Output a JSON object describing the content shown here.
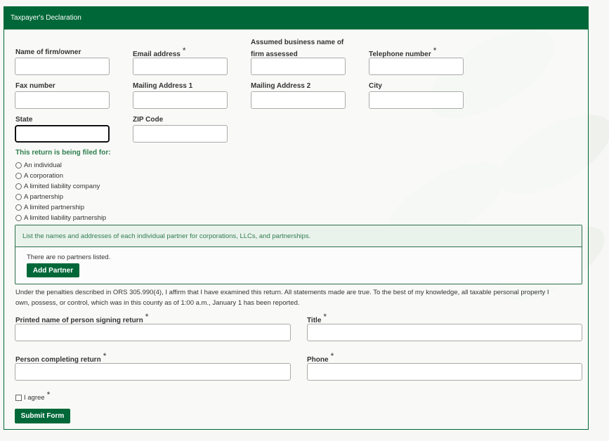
{
  "header": {
    "title": "Taxpayer's Declaration"
  },
  "fields": [
    {
      "label": "Name of firm/owner",
      "required": false,
      "value": ""
    },
    {
      "label": "Email address",
      "required": true,
      "value": ""
    },
    {
      "label": "Assumed business name of",
      "label2": "firm assessed",
      "required": false,
      "value": ""
    },
    {
      "label": "Telephone number",
      "required": true,
      "value": ""
    },
    {
      "label": "Fax number",
      "required": false,
      "value": ""
    },
    {
      "label": "Mailing Address 1",
      "required": false,
      "value": ""
    },
    {
      "label": "Mailing Address 2",
      "required": false,
      "value": ""
    },
    {
      "label": "City",
      "required": false,
      "value": ""
    },
    {
      "label": "State",
      "required": false,
      "value": "",
      "focused": true
    },
    {
      "label": "ZIP Code",
      "required": false,
      "value": ""
    }
  ],
  "filing": {
    "title": "This return is being filed for:",
    "options": [
      "An individual",
      "A corporation",
      "A limited liability company",
      "A partnership",
      "A limited partnership",
      "A limited liability partnership"
    ]
  },
  "partners": {
    "instruction": "List the names and addresses of each individual partner for corporations, LLCs, and partnerships.",
    "empty": "There are no partners listed.",
    "add_label": "Add Partner"
  },
  "declaration": {
    "line1": "Under the penalties described in ORS 305.990(4), I affirm that I have examined this return. All statements made are true. To the best of my knowledge, all taxable personal property I",
    "line2": "own, possess, or control, which was in this county as of 1:00 a.m., January 1 has been reported."
  },
  "signing": {
    "printed_name": "Printed name of person signing return",
    "title": "Title",
    "person_completing": "Person completing return",
    "phone": "Phone",
    "required_mark": "*"
  },
  "agree": {
    "label": "I agree",
    "checked": false
  },
  "submit_label": "Submit Form",
  "colors": {
    "brand": "#006838",
    "accent_text": "#2e7d4f"
  }
}
